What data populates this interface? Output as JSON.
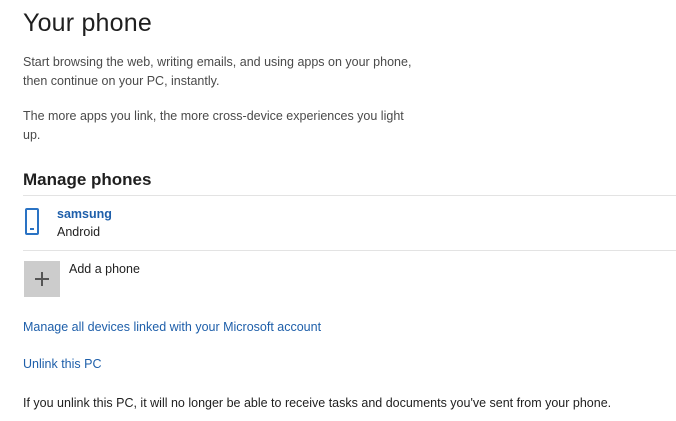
{
  "page": {
    "title": "Your phone",
    "intro_paragraph_1": "Start browsing the web, writing emails, and using apps on your phone, then continue on your PC, instantly.",
    "intro_paragraph_2": "The more apps you link, the more cross-device experiences you light up."
  },
  "manage_phones": {
    "heading": "Manage phones",
    "phones": [
      {
        "name": "samsung",
        "os": "Android",
        "icon": "phone-icon"
      }
    ],
    "add_phone": {
      "label": "Add a phone",
      "icon": "plus-icon"
    }
  },
  "links": {
    "manage_devices": "Manage all devices linked with your Microsoft account",
    "unlink_pc": "Unlink this PC"
  },
  "note": "If you unlink this PC, it will no longer be able to receive tasks and documents you've sent from your phone.",
  "colors": {
    "accent": "#2a73c4",
    "link": "#1e5faa",
    "add_box": "#cccccc"
  }
}
